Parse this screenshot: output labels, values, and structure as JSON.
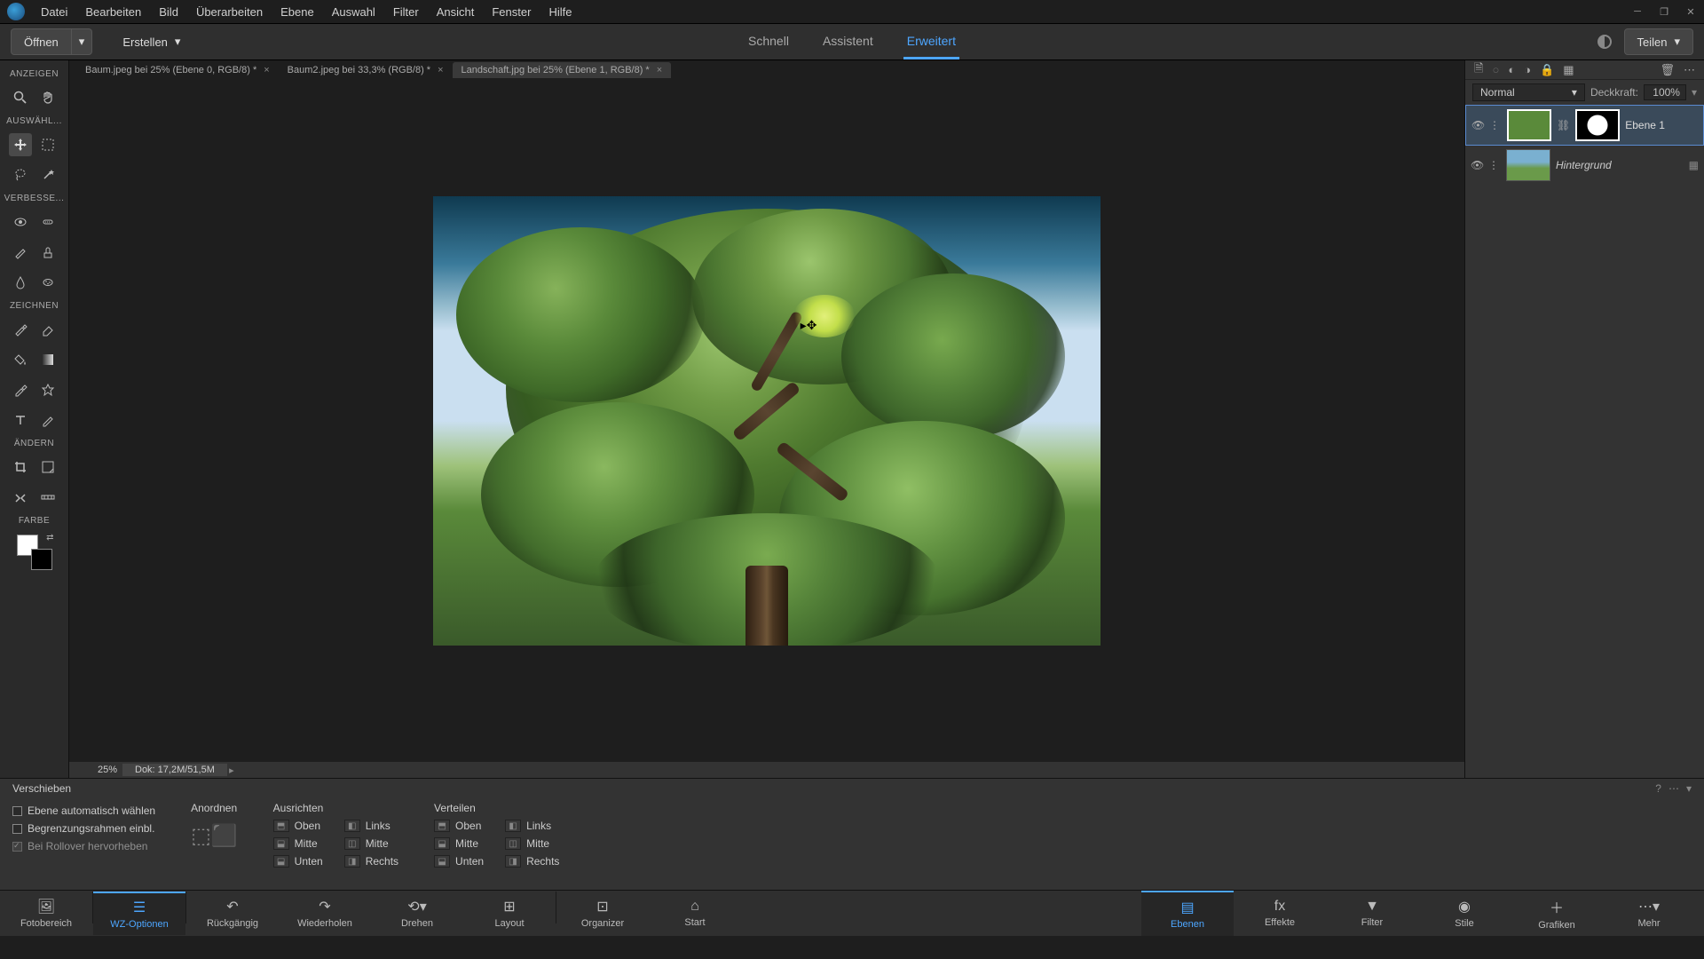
{
  "menu": [
    "Datei",
    "Bearbeiten",
    "Bild",
    "Überarbeiten",
    "Ebene",
    "Auswahl",
    "Filter",
    "Ansicht",
    "Fenster",
    "Hilfe"
  ],
  "secondary": {
    "open": "Öffnen",
    "create": "Erstellen",
    "share": "Teilen"
  },
  "modes": {
    "quick": "Schnell",
    "guided": "Assistent",
    "expert": "Erweitert"
  },
  "tabs": [
    {
      "label": "Baum.jpeg bei 25% (Ebene 0, RGB/8) *",
      "active": false
    },
    {
      "label": "Baum2.jpeg bei 33,3% (RGB/8) *",
      "active": false
    },
    {
      "label": "Landschaft.jpg bei 25% (Ebene 1, RGB/8) *",
      "active": true
    }
  ],
  "toolbar": {
    "anzeigen": "ANZEIGEN",
    "auswahl": "AUSWÄHL...",
    "verbessern": "VERBESSE...",
    "zeichnen": "ZEICHNEN",
    "aendern": "ÄNDERN",
    "farbe": "FARBE"
  },
  "status": {
    "zoom": "25%",
    "doc": "Dok: 17,2M/51,5M"
  },
  "layers": {
    "blend": "Normal",
    "opac_label": "Deckkraft:",
    "opac_val": "100%",
    "items": [
      {
        "name": "Ebene 1"
      },
      {
        "name": "Hintergrund"
      }
    ]
  },
  "options": {
    "title": "Verschieben",
    "checks": [
      "Ebene automatisch wählen",
      "Begrenzungsrahmen einbl.",
      "Bei Rollover hervorheben"
    ],
    "anordnen": "Anordnen",
    "ausrichten": "Ausrichten",
    "verteilen": "Verteilen",
    "align": {
      "oben": "Oben",
      "mitte": "Mitte",
      "unten": "Unten",
      "links": "Links",
      "mittev": "Mitte",
      "rechts": "Rechts"
    }
  },
  "bottom": {
    "left": [
      "Fotobereich",
      "WZ-Optionen",
      "Rückgängig",
      "Wiederholen",
      "Drehen",
      "Layout",
      "Organizer",
      "Start"
    ],
    "right": [
      "Ebenen",
      "Effekte",
      "Filter",
      "Stile",
      "Grafiken",
      "Mehr"
    ]
  }
}
